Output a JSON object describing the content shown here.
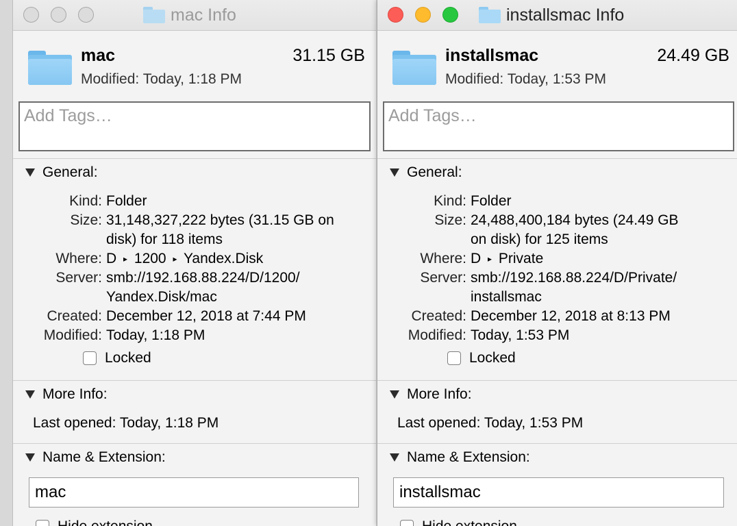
{
  "windows": [
    {
      "title": "mac Info",
      "name": "mac",
      "size_short": "31.15 GB",
      "modified_label": "Modified:",
      "modified": "Today, 1:18 PM",
      "tags_placeholder": "Add Tags…",
      "general": {
        "header": "General:",
        "kind_label": "Kind:",
        "kind": "Folder",
        "size_label": "Size:",
        "size_line1": "31,148,327,222 bytes (31.15 GB on",
        "size_line2": "disk) for 118 items",
        "where_label": "Where:",
        "where_parts": [
          "D",
          "1200",
          "Yandex.Disk"
        ],
        "server_label": "Server:",
        "server_line1": "smb://192.168.88.224/D/1200/",
        "server_line2": "Yandex.Disk/mac",
        "created_label": "Created:",
        "created": "December 12, 2018 at 7:44 PM",
        "modified_label": "Modified:",
        "modified": "Today, 1:18 PM",
        "locked_label": "Locked"
      },
      "more_info": {
        "header": "More Info:",
        "last_opened_label": "Last opened:",
        "last_opened": "Today, 1:18 PM"
      },
      "name_ext": {
        "header": "Name & Extension:",
        "value": "mac",
        "hide_extension_label": "Hide extension"
      }
    },
    {
      "title": "installsmac Info",
      "name": "installsmac",
      "size_short": "24.49 GB",
      "modified_label": "Modified:",
      "modified": "Today, 1:53 PM",
      "tags_placeholder": "Add Tags…",
      "general": {
        "header": "General:",
        "kind_label": "Kind:",
        "kind": "Folder",
        "size_label": "Size:",
        "size_line1": "24,488,400,184 bytes (24.49 GB",
        "size_line2": "on disk) for 125 items",
        "where_label": "Where:",
        "where_parts": [
          "D",
          "Private"
        ],
        "server_label": "Server:",
        "server_line1": "smb://192.168.88.224/D/Private/",
        "server_line2": "installsmac",
        "created_label": "Created:",
        "created": "December 12, 2018 at 8:13 PM",
        "modified_label": "Modified:",
        "modified": "Today, 1:53 PM",
        "locked_label": "Locked"
      },
      "more_info": {
        "header": "More Info:",
        "last_opened_label": "Last opened:",
        "last_opened": "Today, 1:53 PM"
      },
      "name_ext": {
        "header": "Name & Extension:",
        "value": "installsmac",
        "hide_extension_label": "Hide extension"
      }
    }
  ],
  "colors": {
    "close": "#fc5d56",
    "minimize": "#fdbb2d",
    "zoom": "#27c840",
    "folder": "#86c7f2"
  },
  "icons": [
    "folder-icon",
    "disclosure-triangle-icon",
    "path-separator-icon",
    "checkbox-icon"
  ]
}
